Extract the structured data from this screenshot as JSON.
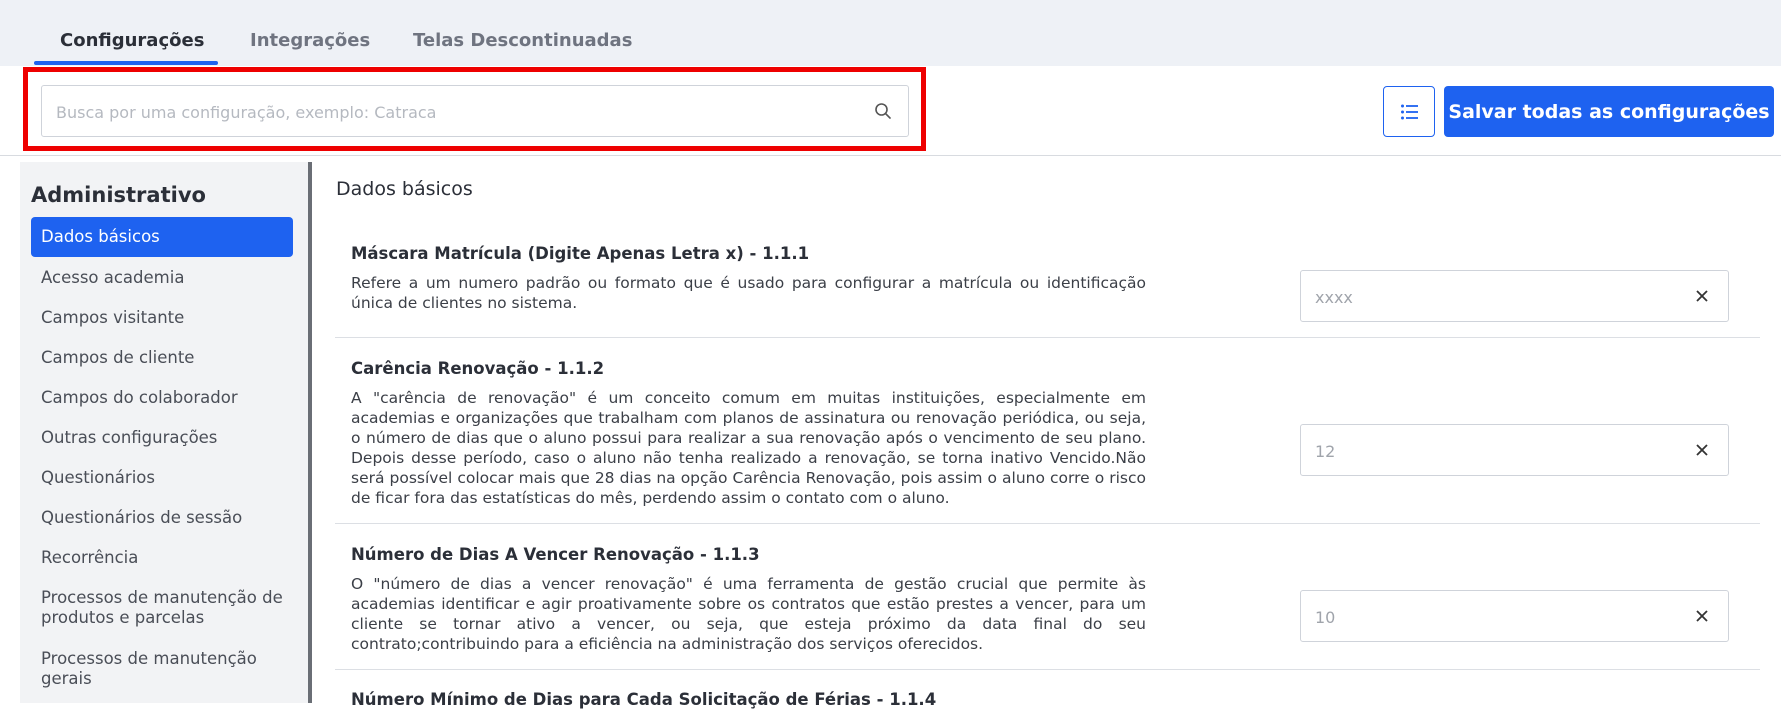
{
  "tabs": [
    {
      "label": "Configurações",
      "active": true
    },
    {
      "label": "Integrações",
      "active": false
    },
    {
      "label": "Telas Descontinuadas",
      "active": false
    }
  ],
  "search": {
    "placeholder": "Busca por uma configuração, exemplo: Catraca",
    "icon": "search-icon"
  },
  "toolbar": {
    "save_label": "Salvar todas as configurações",
    "list_icon": "list-icon"
  },
  "sidebar": {
    "title": "Administrativo",
    "items": [
      {
        "label": "Dados básicos"
      },
      {
        "label": "Acesso academia"
      },
      {
        "label": "Campos visitante"
      },
      {
        "label": "Campos de cliente"
      },
      {
        "label": "Campos do colaborador"
      },
      {
        "label": "Outras configurações"
      },
      {
        "label": "Questionários"
      },
      {
        "label": "Questionários de sessão"
      },
      {
        "label": "Recorrência"
      },
      {
        "label": "Processos de manutenção de produtos e parcelas"
      },
      {
        "label": "Processos de manutenção gerais"
      }
    ]
  },
  "main": {
    "section_title": "Dados básicos",
    "configs": [
      {
        "title": "Máscara Matrícula (Digite Apenas Letra x) - 1.1.1",
        "description": "Refere a um numero padrão ou formato que é usado para configurar a matrícula ou identificação única de clientes no sistema.",
        "value": "xxxx"
      },
      {
        "title": "Carência Renovação - 1.1.2",
        "description": "A \"carência de renovação\" é um conceito comum em muitas instituições, especialmente em academias e organizações que trabalham com planos de assinatura ou renovação periódica, ou seja, o número de dias que o aluno possui para realizar a sua renovação após o vencimento de seu plano. Depois desse período, caso o aluno não tenha realizado a renovação, se torna inativo Vencido.Não será possível colocar mais que 28 dias na opção Carência Renovação, pois assim o aluno corre o risco de ficar fora das estatísticas do mês, perdendo assim o contato com o aluno.",
        "value": "12"
      },
      {
        "title": "Número de Dias A Vencer Renovação - 1.1.3",
        "description": "O \"número de dias a vencer renovação\" é uma ferramenta de gestão crucial que permite às academias identificar e agir proativamente sobre os contratos que estão prestes a vencer, para um cliente se tornar ativo a vencer, ou seja, que esteja próximo da data final do seu contrato;contribuindo para a eficiência na administração dos serviços oferecidos.",
        "value": "10"
      },
      {
        "title": "Número Mínimo de Dias para Cada Solicitação de Férias - 1.1.4"
      }
    ]
  },
  "colors": {
    "accent": "#1e62f0",
    "highlight": "#ee0000"
  }
}
